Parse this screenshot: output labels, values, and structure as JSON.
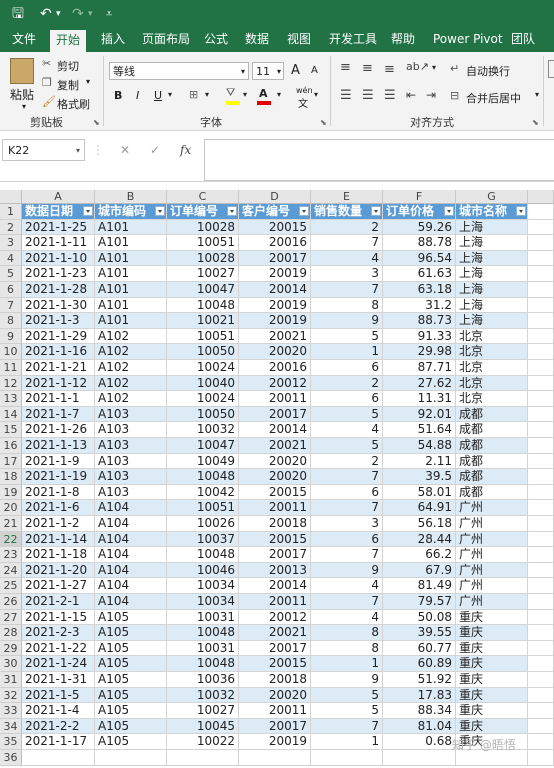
{
  "quick_access": {
    "save": "🖫",
    "undo": "↶",
    "redo": "↷",
    "customize": "⩡"
  },
  "tabs": [
    "文件",
    "开始",
    "插入",
    "页面布局",
    "公式",
    "数据",
    "视图",
    "开发工具",
    "帮助",
    "Power Pivot",
    "团队"
  ],
  "active_tab": "开始",
  "ribbon": {
    "clipboard": {
      "paste": "粘贴",
      "cut": "剪切",
      "copy": "复制",
      "format_painter": "格式刷",
      "group": "剪贴板"
    },
    "font": {
      "name": "等线",
      "size": "11",
      "grow": "A",
      "shrink": "A",
      "bold": "B",
      "italic": "I",
      "underline": "U",
      "phonetic": "wén",
      "group": "字体"
    },
    "alignment": {
      "wrap": "自动换行",
      "merge": "合并后居中",
      "group": "对齐方式"
    }
  },
  "formula_bar": {
    "name_box": "K22",
    "cancel": "✕",
    "enter": "✓",
    "fx": "fx",
    "value": ""
  },
  "columns": [
    "A",
    "B",
    "C",
    "D",
    "E",
    "F",
    "G"
  ],
  "headers": [
    "数据日期",
    "城市编码",
    "订单编号",
    "客户编号",
    "销售数量",
    "订单价格",
    "城市名称"
  ],
  "rows": [
    [
      "2021-1-25",
      "A101",
      "10028",
      "20015",
      "2",
      "59.26",
      "上海"
    ],
    [
      "2021-1-11",
      "A101",
      "10051",
      "20016",
      "7",
      "88.78",
      "上海"
    ],
    [
      "2021-1-10",
      "A101",
      "10028",
      "20017",
      "4",
      "96.54",
      "上海"
    ],
    [
      "2021-1-23",
      "A101",
      "10027",
      "20019",
      "3",
      "61.63",
      "上海"
    ],
    [
      "2021-1-28",
      "A101",
      "10047",
      "20014",
      "7",
      "63.18",
      "上海"
    ],
    [
      "2021-1-30",
      "A101",
      "10048",
      "20019",
      "8",
      "31.2",
      "上海"
    ],
    [
      "2021-1-3",
      "A101",
      "10021",
      "20019",
      "9",
      "88.73",
      "上海"
    ],
    [
      "2021-1-29",
      "A102",
      "10051",
      "20021",
      "5",
      "91.33",
      "北京"
    ],
    [
      "2021-1-16",
      "A102",
      "10050",
      "20020",
      "1",
      "29.98",
      "北京"
    ],
    [
      "2021-1-21",
      "A102",
      "10024",
      "20016",
      "6",
      "87.71",
      "北京"
    ],
    [
      "2021-1-12",
      "A102",
      "10040",
      "20012",
      "2",
      "27.62",
      "北京"
    ],
    [
      "2021-1-1",
      "A102",
      "10024",
      "20011",
      "6",
      "11.31",
      "北京"
    ],
    [
      "2021-1-7",
      "A103",
      "10050",
      "20017",
      "5",
      "92.01",
      "成都"
    ],
    [
      "2021-1-26",
      "A103",
      "10032",
      "20014",
      "4",
      "51.64",
      "成都"
    ],
    [
      "2021-1-13",
      "A103",
      "10047",
      "20021",
      "5",
      "54.88",
      "成都"
    ],
    [
      "2021-1-9",
      "A103",
      "10049",
      "20020",
      "2",
      "2.11",
      "成都"
    ],
    [
      "2021-1-19",
      "A103",
      "10048",
      "20020",
      "7",
      "39.5",
      "成都"
    ],
    [
      "2021-1-8",
      "A103",
      "10042",
      "20015",
      "6",
      "58.01",
      "成都"
    ],
    [
      "2021-1-6",
      "A104",
      "10051",
      "20011",
      "7",
      "64.91",
      "广州"
    ],
    [
      "2021-1-2",
      "A104",
      "10026",
      "20018",
      "3",
      "56.18",
      "广州"
    ],
    [
      "2021-1-14",
      "A104",
      "10037",
      "20015",
      "6",
      "28.44",
      "广州"
    ],
    [
      "2021-1-18",
      "A104",
      "10048",
      "20017",
      "7",
      "66.2",
      "广州"
    ],
    [
      "2021-1-20",
      "A104",
      "10046",
      "20013",
      "9",
      "67.9",
      "广州"
    ],
    [
      "2021-1-27",
      "A104",
      "10034",
      "20014",
      "4",
      "81.49",
      "广州"
    ],
    [
      "2021-2-1",
      "A104",
      "10034",
      "20011",
      "7",
      "79.57",
      "广州"
    ],
    [
      "2021-1-15",
      "A105",
      "10031",
      "20012",
      "4",
      "50.08",
      "重庆"
    ],
    [
      "2021-2-3",
      "A105",
      "10048",
      "20021",
      "8",
      "39.55",
      "重庆"
    ],
    [
      "2021-1-22",
      "A105",
      "10031",
      "20017",
      "8",
      "60.77",
      "重庆"
    ],
    [
      "2021-1-24",
      "A105",
      "10048",
      "20015",
      "1",
      "60.89",
      "重庆"
    ],
    [
      "2021-1-31",
      "A105",
      "10036",
      "20018",
      "9",
      "51.92",
      "重庆"
    ],
    [
      "2021-1-5",
      "A105",
      "10032",
      "20020",
      "5",
      "17.83",
      "重庆"
    ],
    [
      "2021-1-4",
      "A105",
      "10027",
      "20011",
      "5",
      "88.34",
      "重庆"
    ],
    [
      "2021-2-2",
      "A105",
      "10045",
      "20017",
      "7",
      "81.04",
      "重庆"
    ],
    [
      "2021-1-17",
      "A105",
      "10022",
      "20019",
      "1",
      "0.68",
      "重庆"
    ]
  ],
  "empty_row": "36",
  "selected_row": "22",
  "watermark": "知乎 @晤悟",
  "colors": {
    "accent": "#217346",
    "table_header": "#5b9bd5",
    "band": "#ddebf7"
  }
}
